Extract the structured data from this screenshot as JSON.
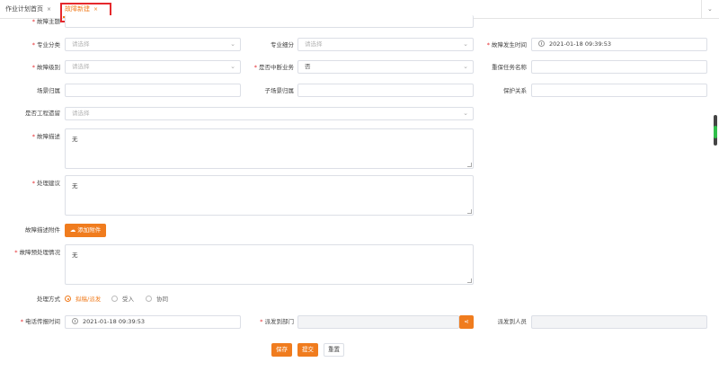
{
  "tabs": [
    {
      "label": "作业计划首页",
      "close": "×"
    },
    {
      "label": "故障新建",
      "close": "×"
    }
  ],
  "tab_menu_icon": "chevron-down-icon",
  "form": {
    "fault_topic_label": "故障主题",
    "specialty_category_label": "专业分类",
    "specialty_category_placeholder": "请选择",
    "specialty_subdivision_label": "专业细分",
    "specialty_subdivision_placeholder": "请选择",
    "occurrence_time_label": "故障发生时间",
    "occurrence_time_value": "2021-01-18 09:39:53",
    "fault_level_label": "故障级别",
    "fault_level_placeholder": "请选择",
    "business_interrupted_label": "是否中断业务",
    "business_interrupted_value": "否",
    "guarantee_task_label": "重保任务名称",
    "scene_belong_label": "场景归属",
    "sub_scene_belong_label": "子场景归属",
    "protection_relation_label": "保护关系",
    "engineering_cause_label": "是否工程遗留",
    "engineering_cause_placeholder": "请选择",
    "fault_description_label": "故障描述",
    "fault_description_value": "无",
    "handling_suggestion_label": "处理建议",
    "handling_suggestion_value": "无",
    "attachment_label": "故障描述附件",
    "attachment_button": "添加附件",
    "pre_handling_label": "故障预处理情况",
    "pre_handling_value": "无",
    "handling_mode_label": "处理方式",
    "handling_modes": [
      {
        "label": "拟稿/派发",
        "selected": true
      },
      {
        "label": "受入",
        "selected": false
      },
      {
        "label": "协同",
        "selected": false
      }
    ],
    "phone_report_time_label": "电话传报时间",
    "phone_report_time_value": "2021-01-18 09:39:53",
    "dispatch_dept_label": "派发到部门",
    "dispatch_person_label": "派发到人员"
  },
  "actions": {
    "save": "保存",
    "submit": "提交",
    "reset": "重置"
  },
  "colors": {
    "accent": "#f07c1e",
    "required": "#e5282c",
    "highlight_box": "#e5282c"
  }
}
